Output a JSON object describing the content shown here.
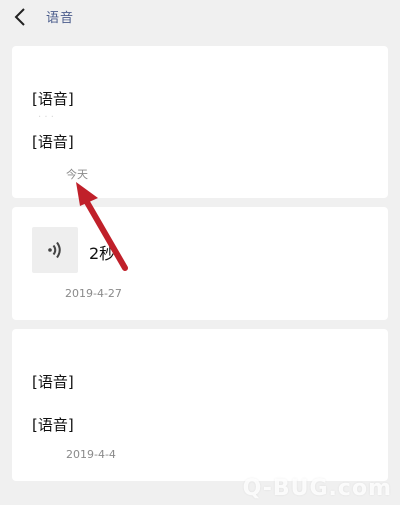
{
  "header": {
    "title": "语音"
  },
  "cards": [
    {
      "messages": [
        "[语音]",
        "[语音]"
      ],
      "date": "今天"
    },
    {
      "voice": {
        "duration": "2秒"
      },
      "date": "2019-4-27"
    },
    {
      "messages": [
        "[语音]",
        "[语音]"
      ],
      "date": "2019-4-4"
    }
  ],
  "icons": {
    "back": "chevron-left-icon",
    "voice": "voice-wave-icon"
  },
  "colors": {
    "background": "#f0f0f0",
    "card": "#ffffff",
    "title": "#4b5d8c",
    "date": "#8a8a8a",
    "annotation_arrow": "#c0202a"
  },
  "watermark": "Q-BUG.com"
}
